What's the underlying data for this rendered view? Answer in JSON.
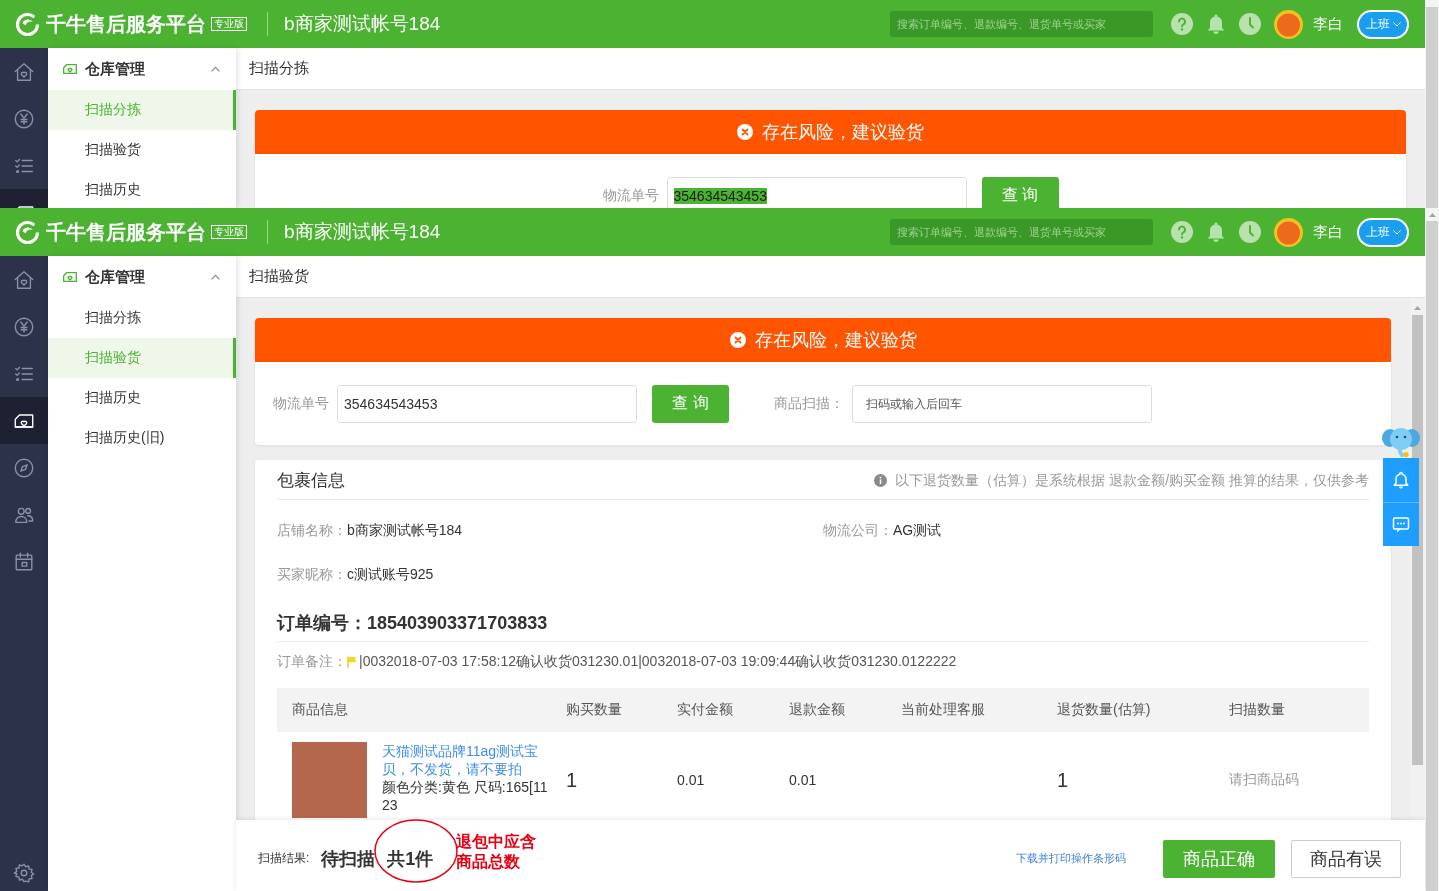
{
  "screens": [
    {
      "header": {
        "title": "千牛售后服务平台",
        "edition": "专业版",
        "account": "b商家测试帐号184",
        "search_placeholder": "搜索订单编号、退款编号、退货单号或买家",
        "user": "李白",
        "shift_button": "上班"
      },
      "rail": {
        "items": [
          {
            "selected": false
          },
          {
            "selected": false
          },
          {
            "selected": false
          },
          {
            "selected": true
          }
        ]
      },
      "menu": {
        "title": "仓库管理",
        "expanded": true,
        "items": [
          {
            "label": "扫描分拣",
            "selected": true
          },
          {
            "label": "扫描验货",
            "selected": false
          },
          {
            "label": "扫描历史",
            "selected": false
          }
        ]
      },
      "breadcrumb": "扫描分拣",
      "alert": {
        "text": "存在风险，建议验货"
      },
      "query": {
        "label": "物流单号",
        "value": "354634543453",
        "value_selected": true,
        "button": "查 询"
      }
    },
    {
      "header": {
        "title": "千牛售后服务平台",
        "edition": "专业版",
        "account": "b商家测试帐号184",
        "search_placeholder": "搜索订单编号、退款编号、退货单号或买家",
        "user": "李白",
        "shift_button": "上班"
      },
      "rail": {
        "items": [
          {
            "selected": false
          },
          {
            "selected": false
          },
          {
            "selected": false
          },
          {
            "selected": true
          },
          {
            "selected": false
          },
          {
            "selected": false
          },
          {
            "selected": false
          }
        ],
        "settings": true
      },
      "menu": {
        "title": "仓库管理",
        "expanded": true,
        "items": [
          {
            "label": "扫描分拣",
            "selected": false
          },
          {
            "label": "扫描验货",
            "selected": true
          },
          {
            "label": "扫描历史",
            "selected": false
          },
          {
            "label": "扫描历史(旧)",
            "selected": false
          }
        ]
      },
      "breadcrumb": "扫描验货",
      "alert": {
        "text": "存在风险，建议验货"
      },
      "query": {
        "label": "物流单号",
        "value": "354634543453",
        "value_selected": false,
        "button": "查 询",
        "scan": {
          "label": "商品扫描：",
          "placeholder": "扫码或输入后回车"
        }
      },
      "package": {
        "title": "包裹信息",
        "note": "以下退货数量（估算）是系统根据 退款金额/购买金额 推算的结果，仅供参考",
        "fields": [
          {
            "label": "店铺名称：",
            "value": "b商家测试帐号184"
          },
          {
            "label": "物流公司：",
            "value": "AG测试"
          },
          {
            "label": "买家昵称：",
            "value": "c测试账号925"
          }
        ],
        "order_number": "订单编号：185403903371703833",
        "remark": {
          "label": "订单备注：",
          "text": "|0032018-07-03 17:58:12确认收货031230.01|0032018-07-03 19:09:44确认收货031230.0122222"
        },
        "table": {
          "columns": [
            "商品信息",
            "购买数量",
            "实付金额",
            "退款金额",
            "当前处理客服",
            "退货数量(估算)",
            "扫描数量"
          ],
          "rows": [
            {
              "product_title": "天猫测试品牌11ag测试宝贝，不发货，请不要拍",
              "sku": "颜色分类:黄色 尺码:165[1123",
              "purchase_qty": "1",
              "paid": "0.01",
              "refund": "0.01",
              "return_qty": "1",
              "scan_qty": "请扫商品码"
            }
          ]
        }
      },
      "footer": {
        "label": "扫描结果:",
        "status": "待扫描",
        "count": "共1件",
        "link": "下载并打印操作条形码",
        "buttons": [
          {
            "label": "商品正确",
            "kind": "primary"
          },
          {
            "label": "商品有误",
            "kind": "default"
          }
        ]
      },
      "annotation": {
        "text": "退包中应含商品总数"
      },
      "float_tools": true
    }
  ]
}
